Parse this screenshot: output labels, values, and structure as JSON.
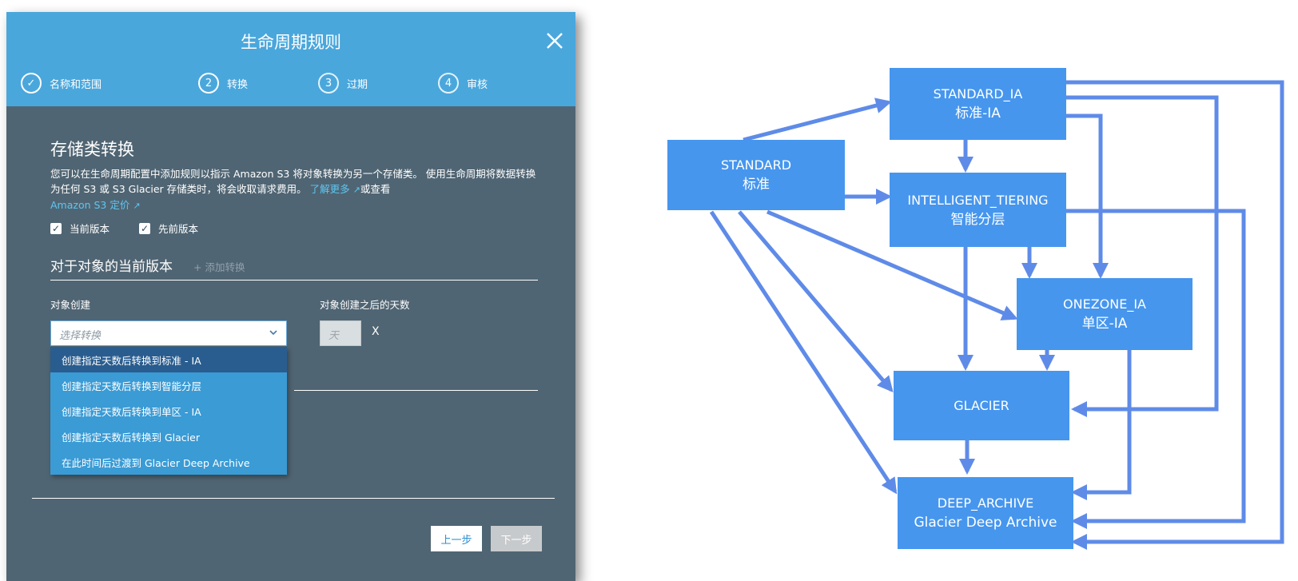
{
  "dialog": {
    "title": "生命周期规则",
    "steps": [
      {
        "num": "✓",
        "label": "名称和范围",
        "state": "done"
      },
      {
        "num": "2",
        "label": "转换",
        "state": "current"
      },
      {
        "num": "3",
        "label": "过期",
        "state": "pending"
      },
      {
        "num": "4",
        "label": "审核",
        "state": "pending"
      }
    ],
    "section_title": "存储类转换",
    "desc_part1": "您可以在生命周期配置中添加规则以指示 Amazon S3 将对象转换为另一个存储类。 使用生命周期将数据转换为任何 S3 或 S3 Glacier 存储类时，将会收取请求费用。",
    "learn_more": "了解更多",
    "or_check": "或查看",
    "pricing_link": "Amazon S3 定价",
    "checkbox_current": "当前版本",
    "checkbox_previous": "先前版本",
    "subhead": "对于对象的当前版本",
    "add_transition": "+ 添加转换",
    "label_object_creation": "对象创建",
    "label_days_after": "对象创建之后的天数",
    "select_placeholder": "选择转换",
    "days_placeholder": "天",
    "x_char": "X",
    "menu_items": [
      "创建指定天数后转换到标准 - IA",
      "创建指定天数后转换到智能分层",
      "创建指定天数后转换到单区 - IA",
      "创建指定天数后转换到 Glacier",
      "在此时间后过渡到 Glacier Deep Archive"
    ],
    "btn_prev": "上一步",
    "btn_next": "下一步",
    "colors": {
      "header": "#4aa7dc",
      "body": "#506573",
      "link": "#5ec6f2",
      "menu": "#3a9bd5",
      "menu_active": "#2a5d8f"
    }
  },
  "diagram": {
    "nodes": {
      "standard": {
        "title": "STANDARD",
        "sub": "标准"
      },
      "standard_ia": {
        "title": "STANDARD_IA",
        "sub": "标准-IA"
      },
      "intelligent": {
        "title": "INTELLIGENT_TIERING",
        "sub": "智能分层"
      },
      "onezone": {
        "title": "ONEZONE_IA",
        "sub": "单区-IA"
      },
      "glacier": {
        "title": "GLACIER",
        "sub": ""
      },
      "deep": {
        "title": "DEEP_ARCHIVE",
        "sub": "Glacier Deep Archive"
      }
    },
    "node_color": "#4696ee",
    "arrow_color": "#5f8be8"
  }
}
